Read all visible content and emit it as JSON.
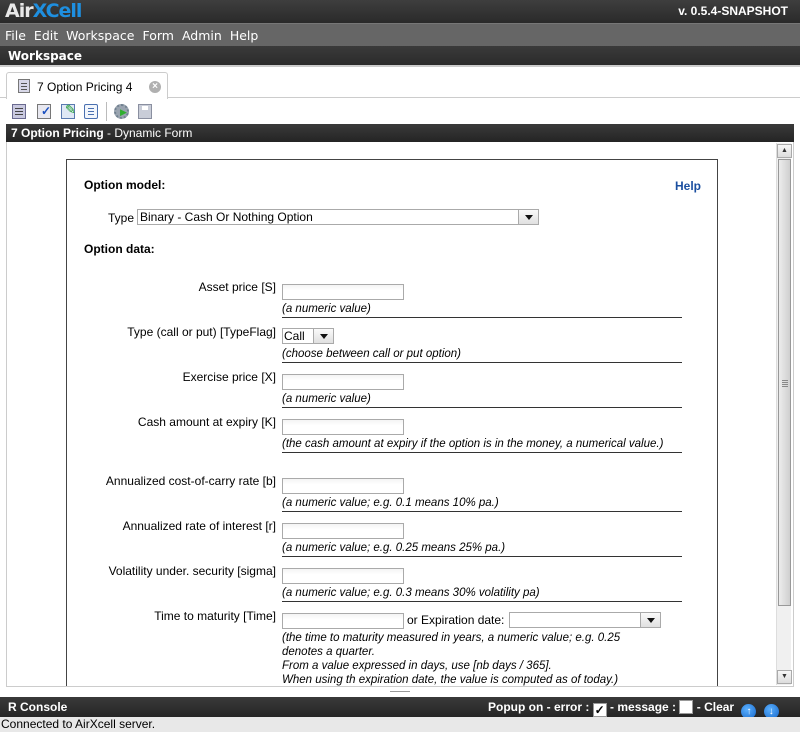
{
  "app": {
    "logo_part1": "Air",
    "logo_part2": "XCell",
    "version": "v. 0.5.4-SNAPSHOT"
  },
  "menu": {
    "items": [
      "File",
      "Edit",
      "Workspace",
      "Form",
      "Admin",
      "Help"
    ]
  },
  "workspace": {
    "title": "Workspace"
  },
  "tab": {
    "label": "7 Option Pricing 4",
    "close_icon": "close-circle-icon"
  },
  "toolbar": {
    "icons": [
      "form-icon",
      "validate-icon",
      "edit-icon",
      "details-icon",
      "run-icon",
      "save-icon"
    ]
  },
  "form_header": {
    "title": "7 Option Pricing",
    "subtitle": " - Dynamic Form"
  },
  "form": {
    "option_model_heading": "Option model:",
    "help_link": "Help",
    "type_label": "Type",
    "type_value": "Binary - Cash Or Nothing Option",
    "option_data_heading": "Option data:",
    "fields": [
      {
        "label": "Asset price [S]",
        "value": "",
        "hint": "(a numeric value)"
      },
      {
        "label": "Type (call or put) [TypeFlag]",
        "value": "Call",
        "hint": "(choose between call or put option)"
      },
      {
        "label": "Exercise price [X]",
        "value": "",
        "hint": "(a numeric value)"
      },
      {
        "label": "Cash amount at expiry [K]",
        "value": "",
        "hint": "(the cash amount at expiry if the option is in the money, a numerical value.)"
      },
      {
        "label": "Annualized cost-of-carry rate [b]",
        "value": "",
        "hint": "(a numeric value; e.g. 0.1 means 10% pa.)"
      },
      {
        "label": "Annualized rate of interest [r]",
        "value": "",
        "hint": "(a numeric value; e.g. 0.25 means 25% pa.)"
      },
      {
        "label": "Volatility under. security [sigma]",
        "value": "",
        "hint": "(a numeric value; e.g. 0.3 means 30% volatility pa)"
      },
      {
        "label": "Time to maturity [Time]",
        "value": "",
        "or_text": "or Expiration date:",
        "expiration_value": "",
        "hint_lines": [
          "(the time to maturity measured in years, a numeric value; e.g. 0.25",
          "denotes a quarter.",
          "From a value expressed in days, use [nb days / 365].",
          "When using th expiration date, the value is computed as of today.)"
        ]
      }
    ]
  },
  "console": {
    "title": "R Console",
    "popup_on_error": "Popup on - error :",
    "error_checked": true,
    "message_label": "- message :",
    "message_checked": false,
    "clear_label": "- Clear",
    "check_mark": "✓",
    "up_arrow": "↑",
    "down_arrow": "↓"
  },
  "status": {
    "text": "Connected to AirXcell server."
  }
}
